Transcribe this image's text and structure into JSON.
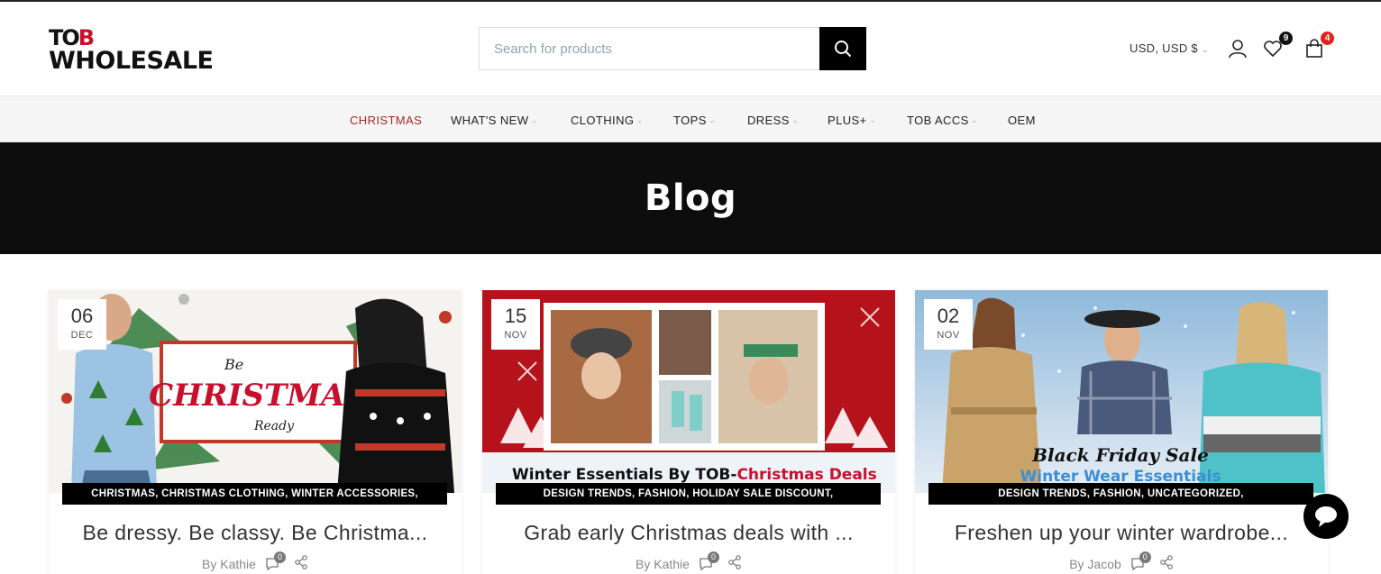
{
  "header": {
    "logo_top": "TOB",
    "logo_bottom": "WHOLESALE",
    "search_placeholder": "Search for products",
    "currency": "USD, USD $",
    "wishlist_count": "9",
    "cart_count": "4"
  },
  "nav": {
    "items": [
      {
        "label": "CHRISTMAS"
      },
      {
        "label": "WHAT'S NEW"
      },
      {
        "label": "CLOTHING"
      },
      {
        "label": "TOPS"
      },
      {
        "label": "DRESS"
      },
      {
        "label": "PLUS+"
      },
      {
        "label": "TOB ACCS"
      },
      {
        "label": "OEM"
      }
    ]
  },
  "banner": {
    "title": "Blog"
  },
  "posts": [
    {
      "day": "06",
      "month": "DEC",
      "image_text": [
        "Be",
        "CHRISTMAS",
        "Ready"
      ],
      "categories": "CHRISTMAS, CHRISTMAS CLOTHING, WINTER ACCESSORIES,",
      "title": "Be dressy. Be classy. Be Christma...",
      "author": "By Kathie",
      "comments": "0"
    },
    {
      "day": "15",
      "month": "NOV",
      "image_text": [
        "Winter Essentials By TOB-",
        "Christmas Deals"
      ],
      "categories": "DESIGN TRENDS, FASHION, HOLIDAY SALE DISCOUNT,",
      "title": "Grab early Christmas deals with ...",
      "author": "By Kathie",
      "comments": "0"
    },
    {
      "day": "02",
      "month": "NOV",
      "image_text": [
        "Black Friday Sale",
        "Winter Wear Essentials"
      ],
      "categories": "DESIGN TRENDS, FASHION, UNCATEGORIZED,",
      "title": "Freshen up your winter wardrobe...",
      "author": "By Jacob",
      "comments": "0"
    }
  ],
  "colors": {
    "accent": "#c8102e",
    "active_nav": "#a52a2a",
    "banner_bg": "#0d0d0d"
  }
}
